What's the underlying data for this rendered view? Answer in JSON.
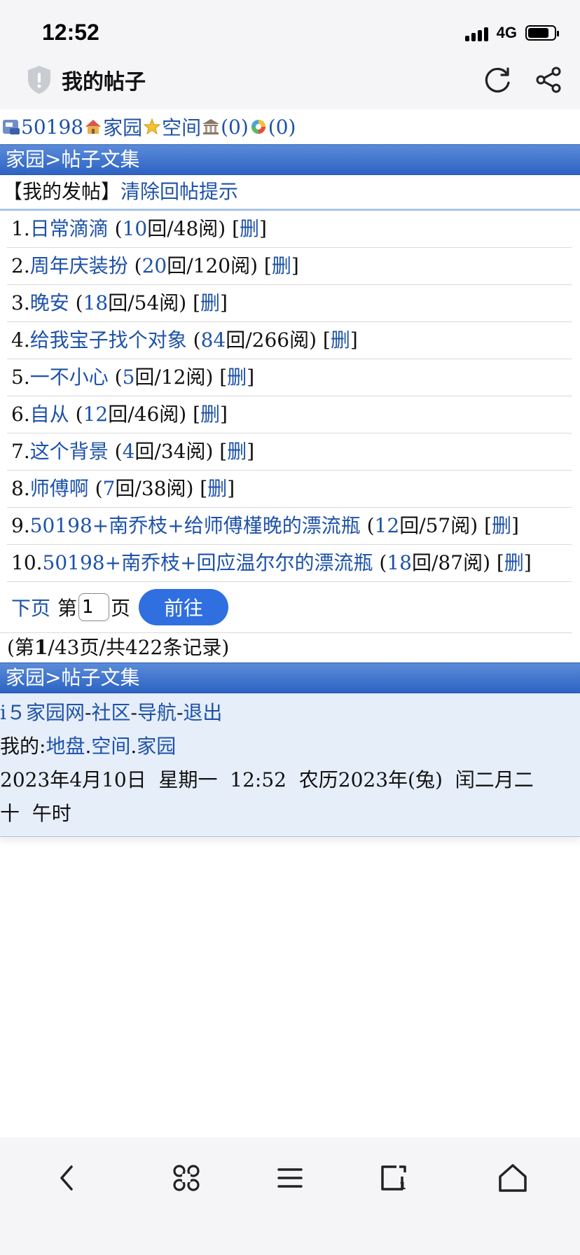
{
  "status": {
    "time": "12:52",
    "network": "4G"
  },
  "nav": {
    "title": "我的帖子"
  },
  "toprow": {
    "user_id": "50198",
    "home": "家园",
    "space": "空间",
    "count1": "(0)",
    "count2": "(0)"
  },
  "breadcrumb": "家园>帖子文集",
  "subtitle": {
    "label": "【我的发帖】",
    "clear_link": "清除回帖提示"
  },
  "posts": [
    {
      "num": "1.",
      "title": "日常滴滴",
      "replies": "10",
      "reads": "回/48阅)",
      "del": "删"
    },
    {
      "num": "2.",
      "title": "周年庆装扮",
      "replies": "20",
      "reads": "回/120阅)",
      "del": "删"
    },
    {
      "num": "3.",
      "title": "晚安",
      "replies": "18",
      "reads": "回/54阅)",
      "del": "删"
    },
    {
      "num": "4.",
      "title": "给我宝子找个对象",
      "replies": "84",
      "reads": "回/266阅)",
      "del": "删"
    },
    {
      "num": "5.",
      "title": "一不小心",
      "replies": "5",
      "reads": "回/12阅)",
      "del": "删"
    },
    {
      "num": "6.",
      "title": "自从",
      "replies": "12",
      "reads": "回/46阅)",
      "del": "删"
    },
    {
      "num": "7.",
      "title": "这个背景",
      "replies": "4",
      "reads": "回/34阅)",
      "del": "删"
    },
    {
      "num": "8.",
      "title": "师傅啊",
      "replies": "7",
      "reads": "回/38阅)",
      "del": "删"
    },
    {
      "num": "9.",
      "title": "50198+南乔枝+给师傅槿晚的漂流瓶",
      "replies": "12",
      "reads": "回/57阅)",
      "del": "删"
    },
    {
      "num": "10.",
      "title": "50198+南乔枝+回应温尔尔的漂流瓶",
      "replies": "18",
      "reads": "回/87阅)",
      "del": "删"
    }
  ],
  "pager": {
    "next": "下页",
    "page_prefix": "第",
    "page_value": "1",
    "page_suffix": "页",
    "go": "前往"
  },
  "record": {
    "prefix": "(第",
    "current": "1",
    "rest": "/43页/共422条记录)"
  },
  "breadcrumb2": "家园>帖子文集",
  "footer": {
    "site": "i５家园网",
    "community": "社区",
    "nav": "导航",
    "logout": "退出",
    "mine_label": "我的:",
    "land": "地盘",
    "space": "空间",
    "home": "家园",
    "date_line1": "2023年4月10日  星期一  12:52  农历2023年(兔)  闰二月二",
    "date_line2": "十  午时"
  }
}
